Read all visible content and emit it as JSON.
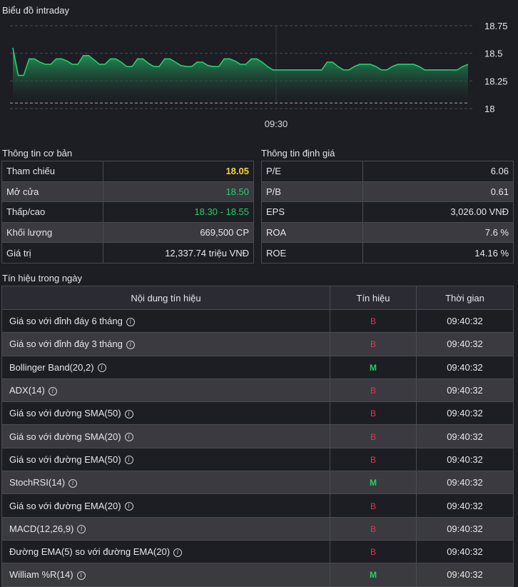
{
  "chart": {
    "title": "Biểu đồ intraday",
    "y_ticks": [
      "18.75",
      "18.5",
      "18.25",
      "18"
    ],
    "x_tick": "09:30"
  },
  "chart_data": {
    "type": "area",
    "title": "Biểu đồ intraday",
    "ylim": [
      18.0,
      18.75
    ],
    "reference": 18.05,
    "x_labels": [
      "09:30"
    ],
    "grid": "horizontal-dashed",
    "values": [
      18.55,
      18.3,
      18.3,
      18.45,
      18.45,
      18.42,
      18.4,
      18.4,
      18.45,
      18.45,
      18.43,
      18.4,
      18.4,
      18.48,
      18.48,
      18.44,
      18.4,
      18.4,
      18.45,
      18.45,
      18.42,
      18.38,
      18.38,
      18.45,
      18.45,
      18.41,
      18.38,
      18.38,
      18.45,
      18.45,
      18.42,
      18.39,
      18.38,
      18.38,
      18.42,
      18.42,
      18.39,
      18.38,
      18.38,
      18.45,
      18.45,
      18.43,
      18.4,
      18.4,
      18.45,
      18.45,
      18.42,
      18.38,
      18.35,
      18.35,
      18.35,
      18.35,
      18.35,
      18.35,
      18.35,
      18.35,
      18.35,
      18.35,
      18.42,
      18.42,
      18.38,
      18.35,
      18.35,
      18.38,
      18.4,
      18.4,
      18.4,
      18.38,
      18.35,
      18.35,
      18.38,
      18.4,
      18.4,
      18.4,
      18.4,
      18.38,
      18.35,
      18.35,
      18.35,
      18.35,
      18.35,
      18.35,
      18.35,
      18.38,
      18.4
    ],
    "colors": {
      "line": "#22d171",
      "fill_top": "#1aa65a",
      "fill_bottom": "#1d1d24",
      "reference": "#a8a8b0"
    }
  },
  "basic": {
    "title": "Thông tin cơ bản",
    "rows": [
      {
        "label": "Tham chiếu",
        "value": "18.05",
        "color": "yellow"
      },
      {
        "label": "Mở cửa",
        "value": "18.50",
        "color": "green"
      },
      {
        "label": "Thấp/cao",
        "value": "18.30 - 18.55",
        "color": "green"
      },
      {
        "label": "Khối lượng",
        "value": "669,500 CP",
        "color": ""
      },
      {
        "label": "Giá trị",
        "value": "12,337.74 triệu VNĐ",
        "color": ""
      }
    ]
  },
  "valuation": {
    "title": "Thông tin định giá",
    "rows": [
      {
        "label": "P/E",
        "value": "6.06"
      },
      {
        "label": "P/B",
        "value": "0.61"
      },
      {
        "label": "EPS",
        "value": "3,026.00 VNĐ"
      },
      {
        "label": "ROA",
        "value": "7.6 %"
      },
      {
        "label": "ROE",
        "value": "14.16 %"
      }
    ]
  },
  "signals": {
    "title": "Tín hiệu trong ngày",
    "headers": {
      "name": "Nội dung tín hiệu",
      "signal": "Tín hiệu",
      "time": "Thời gian"
    },
    "rows": [
      {
        "name": "Giá so với đỉnh đáy 6 tháng",
        "signal": "B",
        "time": "09:40:32"
      },
      {
        "name": "Giá so với đỉnh đáy 3 tháng",
        "signal": "B",
        "time": "09:40:32"
      },
      {
        "name": "Bollinger Band(20,2)",
        "signal": "M",
        "time": "09:40:32"
      },
      {
        "name": "ADX(14)",
        "signal": "B",
        "time": "09:40:32"
      },
      {
        "name": "Giá so với đường SMA(50)",
        "signal": "B",
        "time": "09:40:32"
      },
      {
        "name": "Giá so với đường SMA(20)",
        "signal": "B",
        "time": "09:40:32"
      },
      {
        "name": "Giá so với đường EMA(50)",
        "signal": "B",
        "time": "09:40:32"
      },
      {
        "name": "StochRSI(14)",
        "signal": "M",
        "time": "09:40:32"
      },
      {
        "name": "Giá so với đường EMA(20)",
        "signal": "B",
        "time": "09:40:32"
      },
      {
        "name": "MACD(12,26,9)",
        "signal": "B",
        "time": "09:40:32"
      },
      {
        "name": "Đường EMA(5) so với đường EMA(20)",
        "signal": "B",
        "time": "09:40:32"
      },
      {
        "name": "William %R(14)",
        "signal": "M",
        "time": "09:40:32"
      }
    ]
  }
}
